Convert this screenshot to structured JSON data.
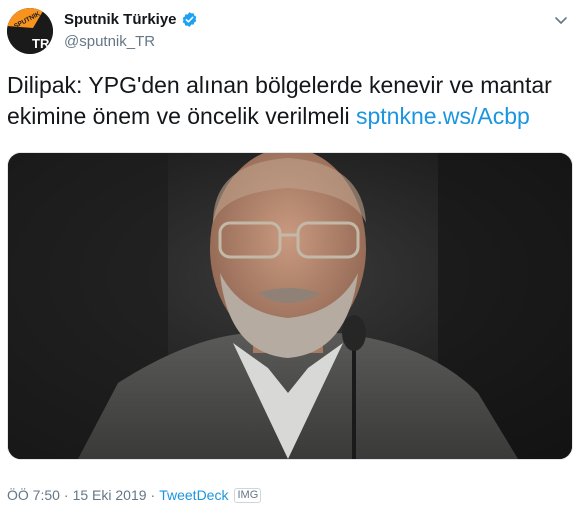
{
  "account": {
    "display_name": "Sputnik Türkiye",
    "handle": "@sputnik_TR",
    "verified": true,
    "avatar_text_top": "SPUTNIK",
    "avatar_text_bottom": "TR",
    "avatar_accent": "#f7931e"
  },
  "tweet": {
    "text": "Dilipak: YPG'den alınan bölgelerde kenevir ve mantar ekimine önem ve öncelik verilmeli ",
    "link": "sptnkne.ws/Acbp"
  },
  "footer": {
    "time": "ÖÖ 7:50",
    "separator": "·",
    "date": "15 Eki 2019",
    "app": "TweetDeck",
    "badge": "IMG"
  },
  "colors": {
    "link": "#1b95e0",
    "secondary_text": "#657786",
    "verified": "#1da1f2"
  },
  "icons": {
    "verified": "verified-badge-icon",
    "menu": "chevron-down-icon"
  }
}
